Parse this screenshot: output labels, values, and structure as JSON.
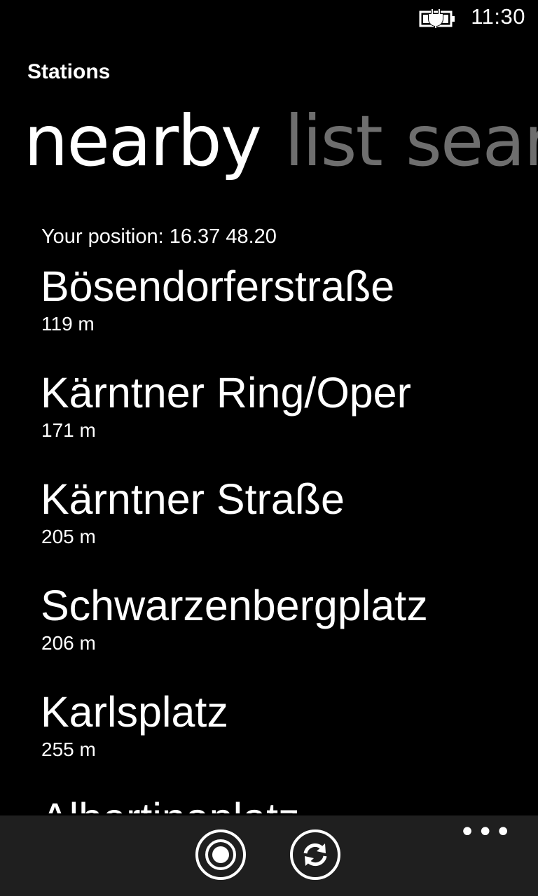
{
  "status_bar": {
    "time": "11:30",
    "icons": [
      "battery-charging-icon"
    ]
  },
  "app": {
    "title": "Stations"
  },
  "pivot": {
    "items": [
      {
        "label": "nearby",
        "active": true
      },
      {
        "label": "list",
        "active": false
      },
      {
        "label": "search",
        "active": false
      }
    ]
  },
  "nearby": {
    "position_text": "Your position: 16.37 48.20",
    "stations": [
      {
        "name": "Bösendorferstraße",
        "distance": "119 m"
      },
      {
        "name": "Kärntner Ring/Oper",
        "distance": "171 m"
      },
      {
        "name": "Kärntner Straße",
        "distance": "205 m"
      },
      {
        "name": "Schwarzenbergplatz",
        "distance": "206 m"
      },
      {
        "name": "Karlsplatz",
        "distance": "255 m"
      },
      {
        "name": "Albertinaplatz",
        "distance": ""
      }
    ]
  },
  "app_bar": {
    "buttons": [
      {
        "icon": "locate-icon"
      },
      {
        "icon": "refresh-icon"
      }
    ],
    "more_label": "•••"
  },
  "colors": {
    "background": "#000000",
    "foreground": "#ffffff",
    "inactive_pivot": "#6e6e6e",
    "app_bar": "#1f1f1f"
  }
}
